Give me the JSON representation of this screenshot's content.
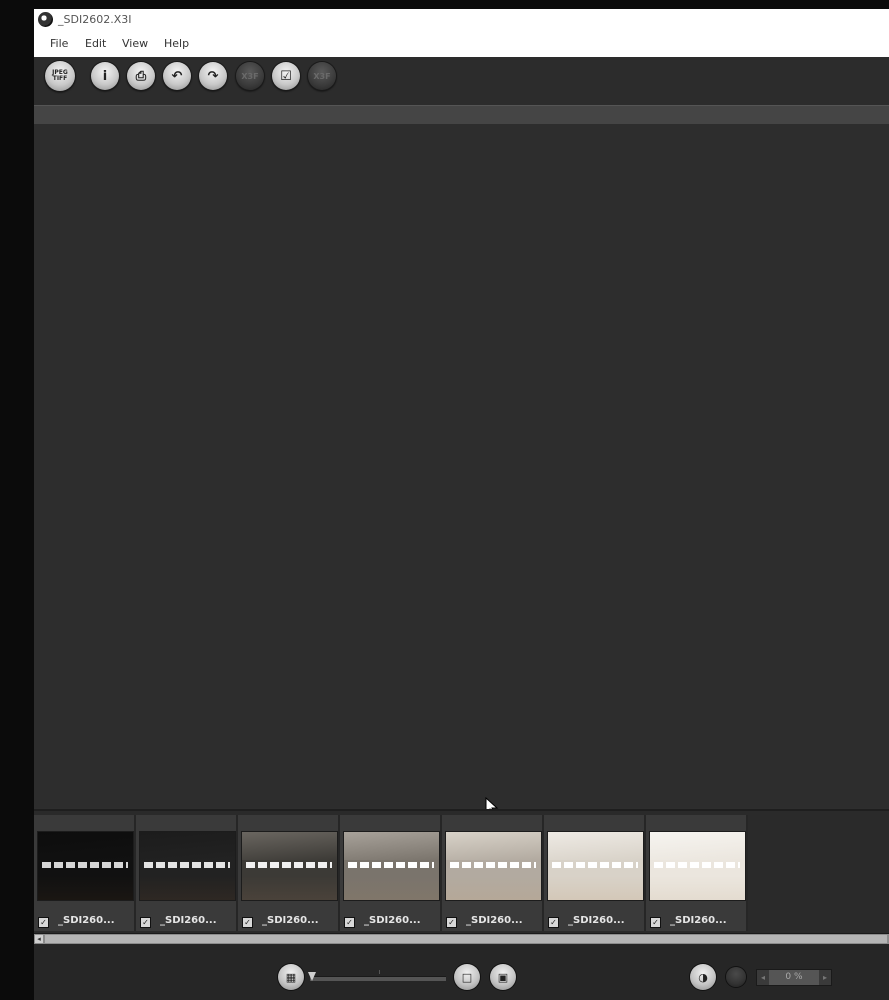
{
  "window": {
    "title": "_SDI2602.X3I"
  },
  "menu": [
    {
      "label": "File"
    },
    {
      "label": "Edit"
    },
    {
      "label": "View"
    },
    {
      "label": "Help"
    }
  ],
  "toolbar": {
    "jpeg_tiff_label": "JPEG TIFF",
    "info_glyph": "i",
    "print_glyph": "⎙",
    "rotate_left_glyph": "↶",
    "rotate_right_glyph": "↷",
    "x3f_label": "X3F",
    "check_glyph": "☑",
    "x3f_disabled_label": "X3F"
  },
  "filmstrip": {
    "thumbnails": [
      {
        "label": "_SDI260...",
        "checked": true,
        "exposure": "very-dark"
      },
      {
        "label": "_SDI260...",
        "checked": true,
        "exposure": "dark"
      },
      {
        "label": "_SDI260...",
        "checked": true,
        "exposure": "medium"
      },
      {
        "label": "_SDI260...",
        "checked": true,
        "exposure": "normal"
      },
      {
        "label": "_SDI260...",
        "checked": true,
        "exposure": "bright"
      },
      {
        "label": "_SDI260...",
        "checked": true,
        "exposure": "very-bright"
      },
      {
        "label": "_SDI260...",
        "checked": true,
        "exposure": "overexposed"
      }
    ]
  },
  "bottombar": {
    "zoom_percent": "0 %",
    "grid_view_glyph": "▦",
    "single_view_glyph": "□",
    "compare_view_glyph": "▣",
    "adjust_glyph": "◑",
    "zoom_slider_position": 0
  },
  "colors": {
    "app_bg": "#2e2e2e",
    "preview_bg": "#2d2d2d",
    "filmstrip_bg": "#2a2a2a",
    "label_text": "#e6e6e6"
  },
  "icons": [
    "app-icon",
    "jpeg-tiff-icon",
    "info-icon",
    "print-icon",
    "rotate-left-icon",
    "rotate-right-icon",
    "x3f-icon",
    "check-icon",
    "grid-view-icon",
    "single-view-icon",
    "compare-view-icon",
    "adjust-icon",
    "cursor-icon"
  ]
}
